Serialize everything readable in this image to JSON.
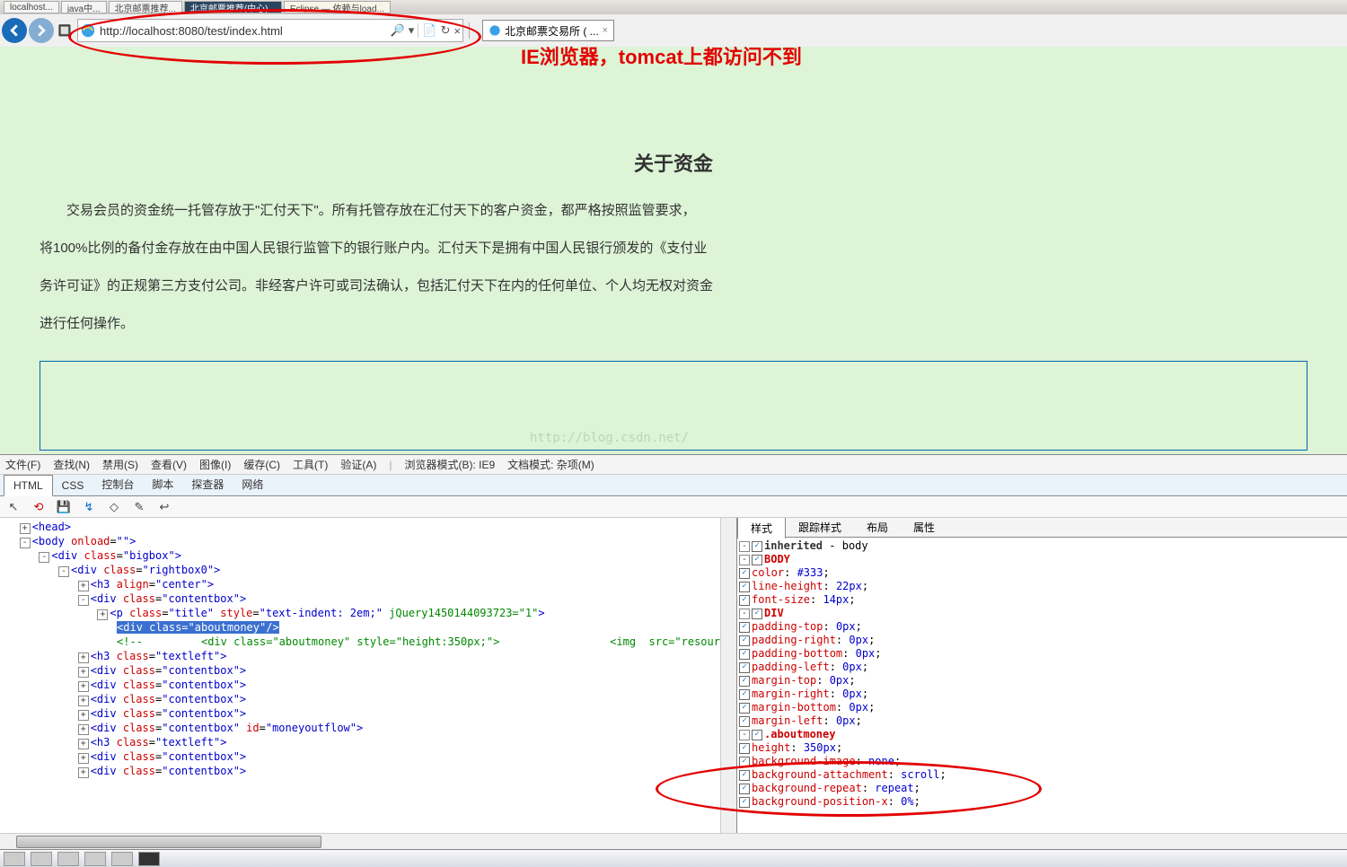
{
  "taskbar_tabs": [
    "localhost...",
    "java中...",
    "北京邮票推荐...",
    "北京邮票推荐(中心)...",
    "Eclipse — 依赖与load..."
  ],
  "url": "http://localhost:8080/test/index.html",
  "page_tab": {
    "title": "北京邮票交易所 ( ...",
    "close": "×"
  },
  "annotation": "IE浏览器，tomcat上都访问不到",
  "page": {
    "heading": "关于资金",
    "p1": "交易会员的资金统一托管存放于\"汇付天下\"。所有托管存放在汇付天下的客户资金，都严格按照监管要求，",
    "p2": "将100%比例的备付金存放在由中国人民银行监管下的银行账户内。汇付天下是拥有中国人民银行颁发的《支付业",
    "p3": "务许可证》的正规第三方支付公司。非经客户许可或司法确认，包括汇付天下在内的任何单位、个人均无权对资金",
    "p4": "进行任何操作。"
  },
  "watermark": "http://blog.csdn.net/",
  "menu": {
    "file": "文件(F)",
    "find": "查找(N)",
    "disable": "禁用(S)",
    "view": "查看(V)",
    "image": "图像(I)",
    "cache": "缓存(C)",
    "tools": "工具(T)",
    "validate": "验证(A)",
    "browser_mode": "浏览器模式(B): IE9",
    "doc_mode": "文档模式: 杂项(M)"
  },
  "tabs": {
    "html": "HTML",
    "css": "CSS",
    "console": "控制台",
    "script": "脚本",
    "profiler": "探查器",
    "network": "网络"
  },
  "dom": {
    "head": "<head>",
    "body": "body",
    "body_attr": "onload",
    "body_val": "\"\"",
    "bigbox": "div",
    "bigbox_cls": "bigbox",
    "rightbox": "div",
    "rightbox_cls": "rightbox0",
    "h3": "h3",
    "h3_attr": "align",
    "h3_val": "center",
    "contentbox": "div",
    "contentbox_cls": "contentbox",
    "p": "p",
    "p_cls": "title",
    "p_style": "text-indent: 2em;",
    "p_jq": "jQuery1450144093723=\"1\"",
    "sel": "<div class=\"aboutmoney\"/>",
    "comment1": "<!--",
    "comment2": "<div class=\"aboutmoney\" style=\"height:350px;\">",
    "comment3": "<img  src=\"resources_tes…",
    "textleft": "textleft",
    "moneyoutflow": "moneyoutflow"
  },
  "rtabs": {
    "style": "样式",
    "trace": "跟踪样式",
    "layout": "布局",
    "attrs": "属性"
  },
  "styles": {
    "inherited": "inherited",
    "body_word": "body",
    "body_rule": "BODY",
    "color": "color",
    "color_v": "#333",
    "lh": "line-height",
    "lh_v": "22px",
    "fs": "font-size",
    "fs_v": "14px",
    "div_rule": "DIV",
    "pt": "padding-top",
    "pt_v": "0px",
    "pr": "padding-right",
    "pr_v": "0px",
    "pb": "padding-bottom",
    "pb_v": "0px",
    "pl": "padding-left",
    "pl_v": "0px",
    "mt": "margin-top",
    "mt_v": "0px",
    "mr": "margin-right",
    "mr_v": "0px",
    "mb": "margin-bottom",
    "mb_v": "0px",
    "ml": "margin-left",
    "ml_v": "0px",
    "about_rule": ".aboutmoney",
    "h": "height",
    "h_v": "350px",
    "bi": "background-image",
    "bi_v": "none",
    "ba": "background-attachment",
    "ba_v": "scroll",
    "br": "background-repeat",
    "br_v": "repeat",
    "bpx": "background-position-x",
    "bpx_v": "0%"
  }
}
